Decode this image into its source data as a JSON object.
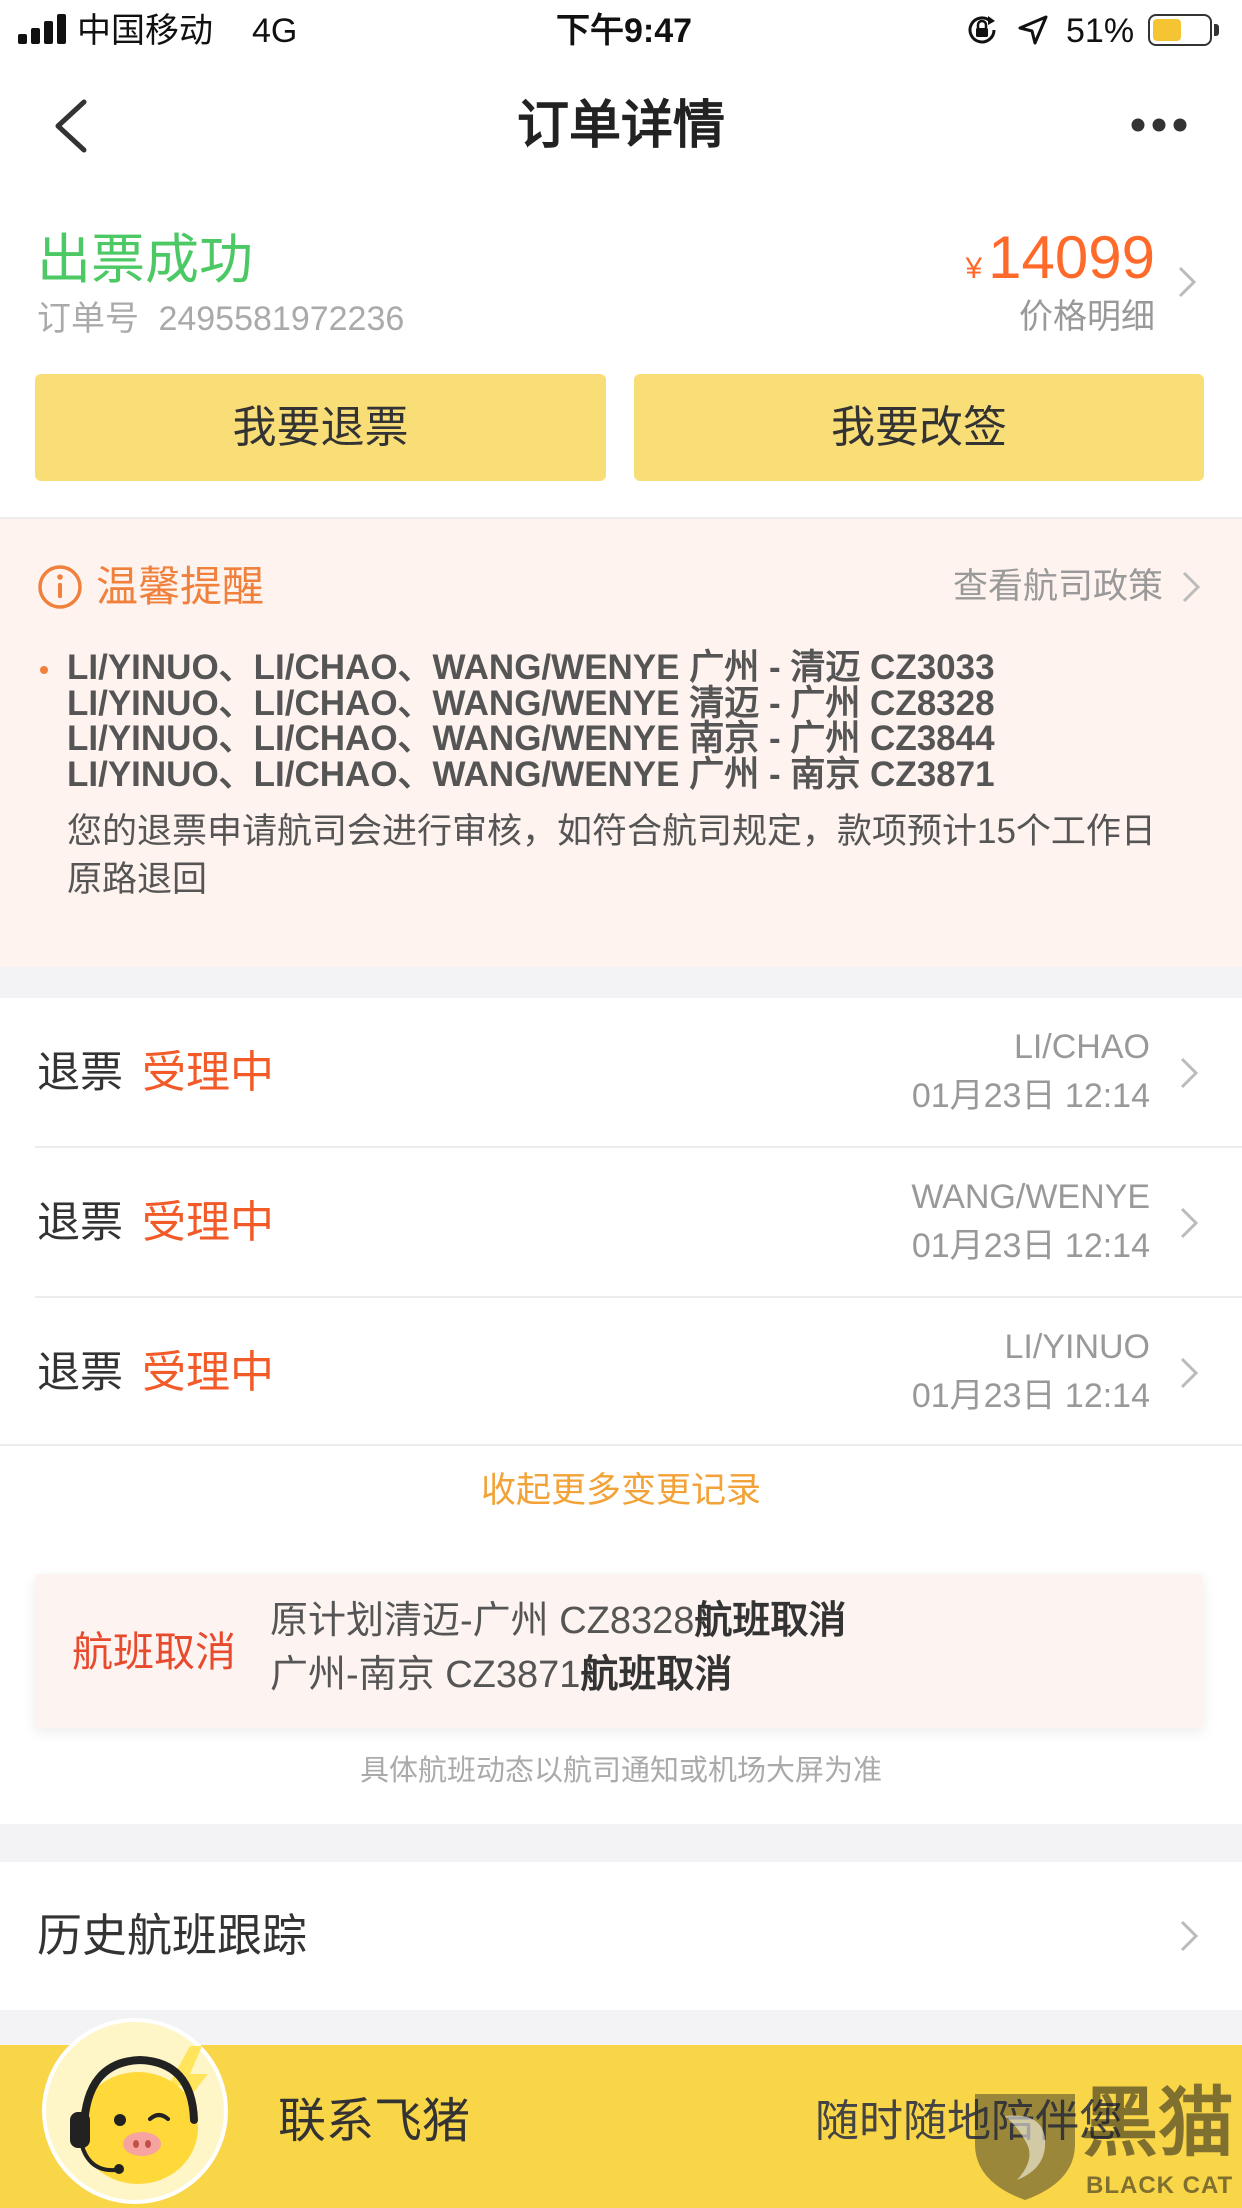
{
  "status_bar": {
    "carrier": "中国移动",
    "network": "4G",
    "time": "下午9:47",
    "battery": "51%",
    "battery_level": 0.51
  },
  "nav": {
    "title": "订单详情"
  },
  "order": {
    "status": "出票成功",
    "order_no_label": "订单号",
    "order_no": "2495581972236",
    "currency": "¥",
    "price": "14099",
    "price_detail": "价格明细"
  },
  "actions": {
    "refund": "我要退票",
    "change": "我要改签"
  },
  "notice": {
    "title": "温馨提醒",
    "policy_link": "查看航司政策",
    "passenger_lines": [
      "LI/YINUO、LI/CHAO、WANG/WENYE 广州 - 清迈 CZ3033",
      "LI/YINUO、LI/CHAO、WANG/WENYE 清迈 - 广州 CZ8328",
      "LI/YINUO、LI/CHAO、WANG/WENYE 南京 - 广州 CZ3844",
      "LI/YINUO、LI/CHAO、WANG/WENYE 广州 - 南京 CZ3871"
    ],
    "message": "您的退票申请航司会进行审核，如符合航司规定，款项预计15个工作日原路退回"
  },
  "refund_records": [
    {
      "type": "退票",
      "status": "受理中",
      "passenger": "LI/CHAO",
      "time": "01月23日 12:14"
    },
    {
      "type": "退票",
      "status": "受理中",
      "passenger": "WANG/WENYE",
      "time": "01月23日 12:14"
    },
    {
      "type": "退票",
      "status": "受理中",
      "passenger": "LI/YINUO",
      "time": "01月23日 12:14"
    }
  ],
  "collapse_link": "收起更多变更记录",
  "cancellation": {
    "label": "航班取消",
    "items": [
      {
        "route": "原计划清迈-广州 CZ8328",
        "status": "航班取消"
      },
      {
        "route": "广州-南京 CZ3871",
        "status": "航班取消"
      }
    ],
    "disclaimer": "具体航班动态以航司通知或机场大屏为准"
  },
  "history": {
    "label": "历史航班跟踪"
  },
  "contact": {
    "label": "联系飞猪",
    "slogan": "随时随地陪伴您"
  },
  "watermark": {
    "cn": "黑猫",
    "en": "BLACK CAT"
  },
  "icons": {
    "back": "back-arrow-icon",
    "more": "more-dots-icon",
    "info": "info-icon",
    "chevron": "chevron-right-icon",
    "signal": "signal-strength-icon",
    "orientation_lock": "orientation-lock-icon",
    "location": "location-arrow-icon",
    "battery": "battery-icon",
    "mascot": "mascot-avatar-icon"
  },
  "colors": {
    "success_green": "#4cc865",
    "price_orange": "#ff6a2b",
    "button_yellow": "#f9de78",
    "notice_bg": "#fef3ef",
    "notice_orange": "#f0813c",
    "status_orange": "#f25a28",
    "link_gold": "#f2a236",
    "cancel_red": "#e84a2e",
    "footer_yellow": "#f9d548",
    "separator_gray": "#f3f3f5"
  }
}
